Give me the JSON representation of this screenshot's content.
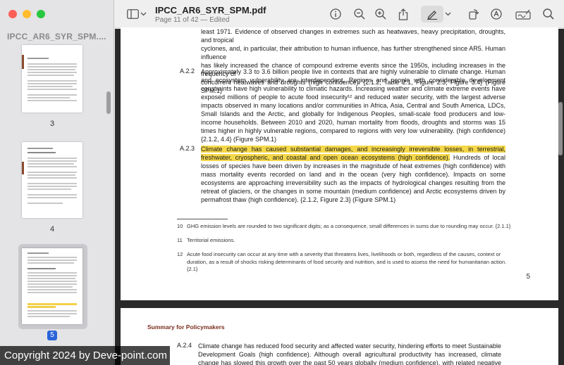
{
  "window": {
    "title": "IPCC_AR6_SYR_SPM.pdf",
    "subtitle": "Page 11 of 42 — Edited"
  },
  "sidebar": {
    "title": "IPCC_AR6_SYR_SPM....",
    "thumbnails": [
      {
        "label": "3"
      },
      {
        "label": "4"
      },
      {
        "label": "5",
        "selected": true
      }
    ]
  },
  "toolbar": {
    "icons": [
      "sidebar-toggle-icon",
      "chevron-down-icon",
      "info-icon",
      "zoom-out-icon",
      "zoom-in-icon",
      "share-icon",
      "markup-pen-icon",
      "chevron-down-icon",
      "rotate-icon",
      "annotate-icon",
      "signature-icon",
      "search-icon"
    ]
  },
  "document": {
    "page1": {
      "intro_lines": [
        "least 1971. Evidence of observed changes in extremes such as heatwaves, heavy precipitation, droughts, and tropical",
        "cyclones, and, in particular, their attribution to human influence, has further strengthened since AR5. Human influence",
        "has likely increased the chance of compound extreme events since the 1950s, including increases in the frequency of",
        "concurrent heatwaves and droughts (high confidence). {2.1.2, Table 2.1, Figure 2.3, Figure 3.4} (Figure SPM.1)"
      ],
      "a22": {
        "num": "A.2.2",
        "text": "Approximately 3.3 to 3.6 billion people live in contexts that are highly vulnerable to climate change. Human and ecosystem vulnerability are interdependent. Regions and people with considerable development constraints have high vulnerability to climatic hazards. Increasing weather and climate extreme events have exposed millions of people to acute food insecurity¹² and reduced water security, with the largest adverse impacts observed in many locations and/or communities in Africa, Asia, Central and South America, LDCs, Small Islands and the Arctic, and globally for Indigenous Peoples, small-scale food producers and low-income households. Between 2010 and 2020, human mortality from floods, droughts and storms was 15 times higher in highly vulnerable regions, compared to regions with very low vulnerability. (high confidence) {2.1.2, 4.4} (Figure SPM.1)"
      },
      "a23": {
        "num": "A.2.3",
        "highlight": "Climate change has caused substantial damages, and increasingly irreversible losses, in terrestrial, freshwater, cryospheric, and coastal and open ocean ecosystems (high confidence).",
        "rest": " Hundreds of local losses of species have been driven by increases in the magnitude of heat extremes (high confidence) with mass mortality events recorded on land and in the ocean (very high confidence). Impacts on some ecosystems are approaching irreversibility such as the impacts of hydrological changes resulting from the retreat of glaciers, or the changes in some mountain (medium confidence) and Arctic ecosystems driven by permafrost thaw (high confidence). {2.1.2, Figure 2.3} (Figure SPM.1)"
      },
      "footnotes": [
        {
          "num": "10",
          "text": "GHG emission levels are rounded to two significant digits; as a consequence, small differences in sums due to rounding may occur. {2.1.1}"
        },
        {
          "num": "11",
          "text": "Territorial emissions."
        },
        {
          "num": "12",
          "text": "Acute food insecurity can occur at any time with a severity that threatens lives, livelihoods or both, regardless of the causes, context or duration, as a result of shocks risking determinants of food security and nutrition, and is used to assess the need for humanitarian action. {2.1}"
        }
      ],
      "page_number": "5"
    },
    "page2": {
      "header": "Summary for Policymakers",
      "a24": {
        "num": "A.2.4",
        "text": "Climate change has reduced food security and affected water security, hindering efforts to meet Sustainable Development Goals (high confidence). Although overall agricultural productivity has increased, climate change has slowed this growth over the past 50 years globally (medium confidence), with related negative impacts mainly in mid-"
      }
    }
  },
  "overlay": {
    "copyright": "Copyright 2024 by Deve-point.com"
  },
  "colors": {
    "highlight": "#f5d84a",
    "accent_selected": "#2a64d9",
    "spm_header": "#7a2e1e"
  }
}
